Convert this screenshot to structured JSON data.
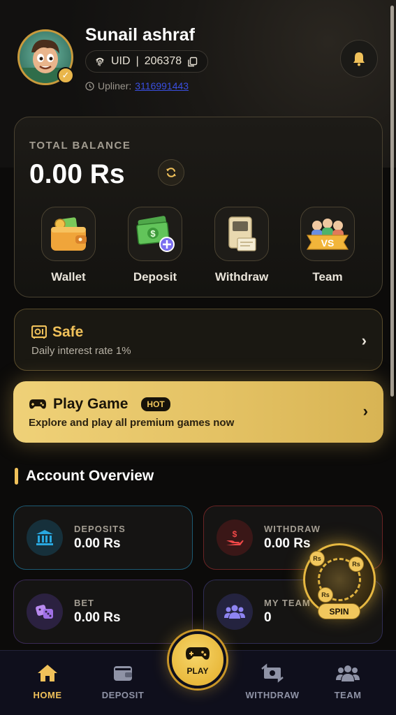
{
  "user": {
    "name": "Sunail ashraf",
    "uid_label": "UID",
    "uid_separator": "|",
    "uid": "206378",
    "upliner_label": "Upliner:",
    "upliner_id": "3116991443"
  },
  "balance": {
    "label": "TOTAL BALANCE",
    "amount": "0.00 Rs"
  },
  "actions": [
    {
      "label": "Wallet",
      "icon": "wallet-icon"
    },
    {
      "label": "Deposit",
      "icon": "deposit-cash-icon"
    },
    {
      "label": "Withdraw",
      "icon": "withdraw-atm-icon"
    },
    {
      "label": "Team",
      "icon": "team-vs-icon"
    }
  ],
  "safe": {
    "title": "Safe",
    "subtitle": "Daily interest rate 1%"
  },
  "play_game": {
    "title": "Play Game",
    "badge": "HOT",
    "subtitle": "Explore and play all premium games now"
  },
  "overview": {
    "title": "Account Overview",
    "stats": [
      {
        "label": "DEPOSITS",
        "value": "0.00 Rs",
        "color": "#1a9fd6"
      },
      {
        "label": "WITHDRAW",
        "value": "0.00 Rs",
        "color": "#e03a3a"
      },
      {
        "label": "BET",
        "value": "0.00 Rs",
        "color": "#9a6ee0"
      },
      {
        "label": "MY TEAM",
        "value": "0",
        "color": "#8a7ef0"
      }
    ]
  },
  "spin": {
    "label": "SPIN",
    "coin_text": "Rs"
  },
  "nav": {
    "home": "HOME",
    "deposit": "DEPOSIT",
    "play": "PLAY",
    "withdraw": "WITHDRAW",
    "team": "TEAM"
  },
  "colors": {
    "accent": "#f0c15a",
    "background": "#0c0b0a"
  }
}
